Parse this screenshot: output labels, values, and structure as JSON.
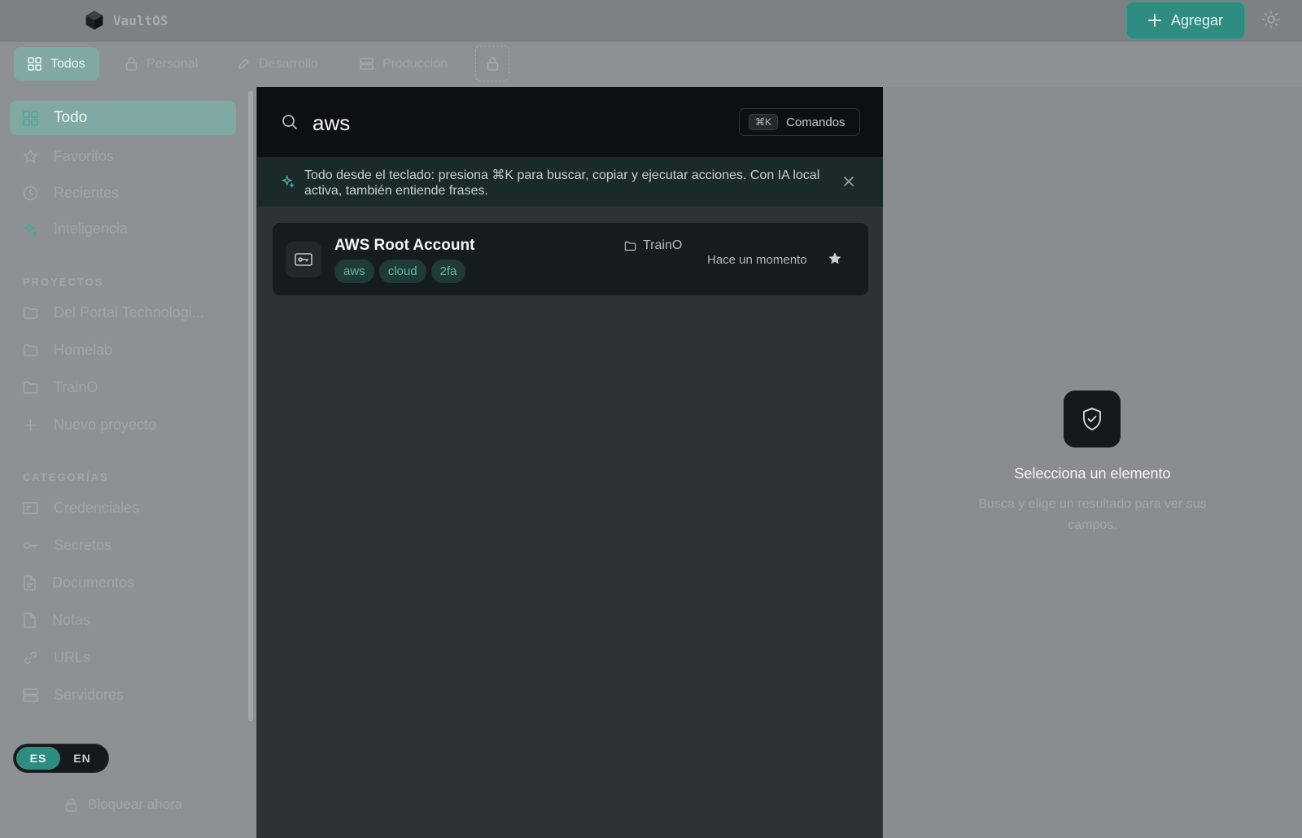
{
  "app": {
    "name": "VaultOS"
  },
  "header": {
    "add_label": "Agregar"
  },
  "tabs": [
    {
      "label": "Todos",
      "icon": "grid-icon"
    },
    {
      "label": "Personal",
      "icon": "lock-icon"
    },
    {
      "label": "Desarrollo",
      "icon": "pencil-icon"
    },
    {
      "label": "Producción",
      "icon": "server-icon"
    }
  ],
  "sidebar": {
    "nav": [
      {
        "label": "Todo",
        "icon": "grid-icon"
      },
      {
        "label": "Favoritos",
        "icon": "star-icon"
      },
      {
        "label": "Recientes",
        "icon": "clock-icon"
      },
      {
        "label": "Inteligencia",
        "icon": "sparkle-icon"
      }
    ],
    "projects_title": "PROYECTOS",
    "projects": [
      {
        "label": "Del Portal Technologi..."
      },
      {
        "label": "Homelab"
      },
      {
        "label": "TrainO"
      }
    ],
    "new_project": "Nuevo proyecto",
    "categories_title": "CATEGORÍAS",
    "categories": [
      {
        "label": "Credenciales",
        "icon": "card-icon"
      },
      {
        "label": "Secretos",
        "icon": "key-icon"
      },
      {
        "label": "Documentos",
        "icon": "document-icon"
      },
      {
        "label": "Notas",
        "icon": "note-icon"
      },
      {
        "label": "URLs",
        "icon": "link-icon"
      },
      {
        "label": "Servidores",
        "icon": "server-icon"
      }
    ],
    "lang": {
      "es": "ES",
      "en": "EN",
      "active": "ES"
    },
    "lock_now": "Bloquear ahora"
  },
  "search": {
    "query": "aws",
    "shortcut": "⌘K",
    "commands_label": "Comandos",
    "hint": "Todo desde el teclado: presiona ⌘K para buscar, copiar y ejecutar acciones. Con IA local activa, también entiende frases."
  },
  "results": [
    {
      "title": "AWS Root Account",
      "tags": [
        "aws",
        "cloud",
        "2fa"
      ],
      "project": "TrainO",
      "time": "Hace un momento",
      "favorite": true
    }
  ],
  "detail": {
    "empty_title": "Selecciona un elemento",
    "empty_subtitle": "Busca y elige un resultado para ver sus campos."
  },
  "colors": {
    "accent": "#2f8c80",
    "tag_text": "#5fb8a8"
  }
}
